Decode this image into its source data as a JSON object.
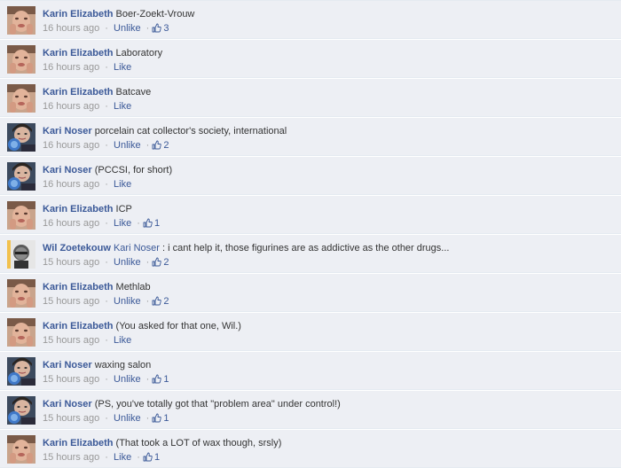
{
  "colors": {
    "link": "#3b5998",
    "meta": "#999999",
    "row_bg": "#edeff4",
    "divider": "#e5eaf1"
  },
  "icons": {
    "like": "thumbs-up-icon"
  },
  "comments": [
    {
      "avatar": "karin",
      "author": "Karin Elizabeth",
      "text": "Boer-Zoekt-Vrouw",
      "time": "16 hours ago",
      "action": "Unlike",
      "likes": "3"
    },
    {
      "avatar": "karin",
      "author": "Karin Elizabeth",
      "text": "Laboratory",
      "time": "16 hours ago",
      "action": "Like",
      "likes": ""
    },
    {
      "avatar": "karin",
      "author": "Karin Elizabeth",
      "text": "Batcave",
      "time": "16 hours ago",
      "action": "Like",
      "likes": ""
    },
    {
      "avatar": "kari",
      "author": "Kari Noser",
      "text": "porcelain cat collector's society, international",
      "time": "16 hours ago",
      "action": "Unlike",
      "likes": "2"
    },
    {
      "avatar": "kari",
      "author": "Kari Noser",
      "text": "(PCCSI, for short)",
      "time": "16 hours ago",
      "action": "Like",
      "likes": ""
    },
    {
      "avatar": "karin",
      "author": "Karin Elizabeth",
      "text": "ICP",
      "time": "16 hours ago",
      "action": "Like",
      "likes": "1"
    },
    {
      "avatar": "wil",
      "author": "Wil Zoetekouw",
      "mention": "Kari Noser",
      "text": ": i cant help it, those figurines are as addictive as the other drugs...",
      "time": "15 hours ago",
      "action": "Unlike",
      "likes": "2"
    },
    {
      "avatar": "karin",
      "author": "Karin Elizabeth",
      "text": "Methlab",
      "time": "15 hours ago",
      "action": "Unlike",
      "likes": "2"
    },
    {
      "avatar": "karin",
      "author": "Karin Elizabeth",
      "text": "(You asked for that one, Wil.)",
      "time": "15 hours ago",
      "action": "Like",
      "likes": ""
    },
    {
      "avatar": "kari",
      "author": "Kari Noser",
      "text": "waxing salon",
      "time": "15 hours ago",
      "action": "Unlike",
      "likes": "1"
    },
    {
      "avatar": "kari",
      "author": "Kari Noser",
      "text": "(PS, you've totally got that \"problem area\" under control!)",
      "time": "15 hours ago",
      "action": "Unlike",
      "likes": "1"
    },
    {
      "avatar": "karin",
      "author": "Karin Elizabeth",
      "text": "(That took a LOT of wax though, srsly)",
      "time": "15 hours ago",
      "action": "Like",
      "likes": "1"
    }
  ]
}
